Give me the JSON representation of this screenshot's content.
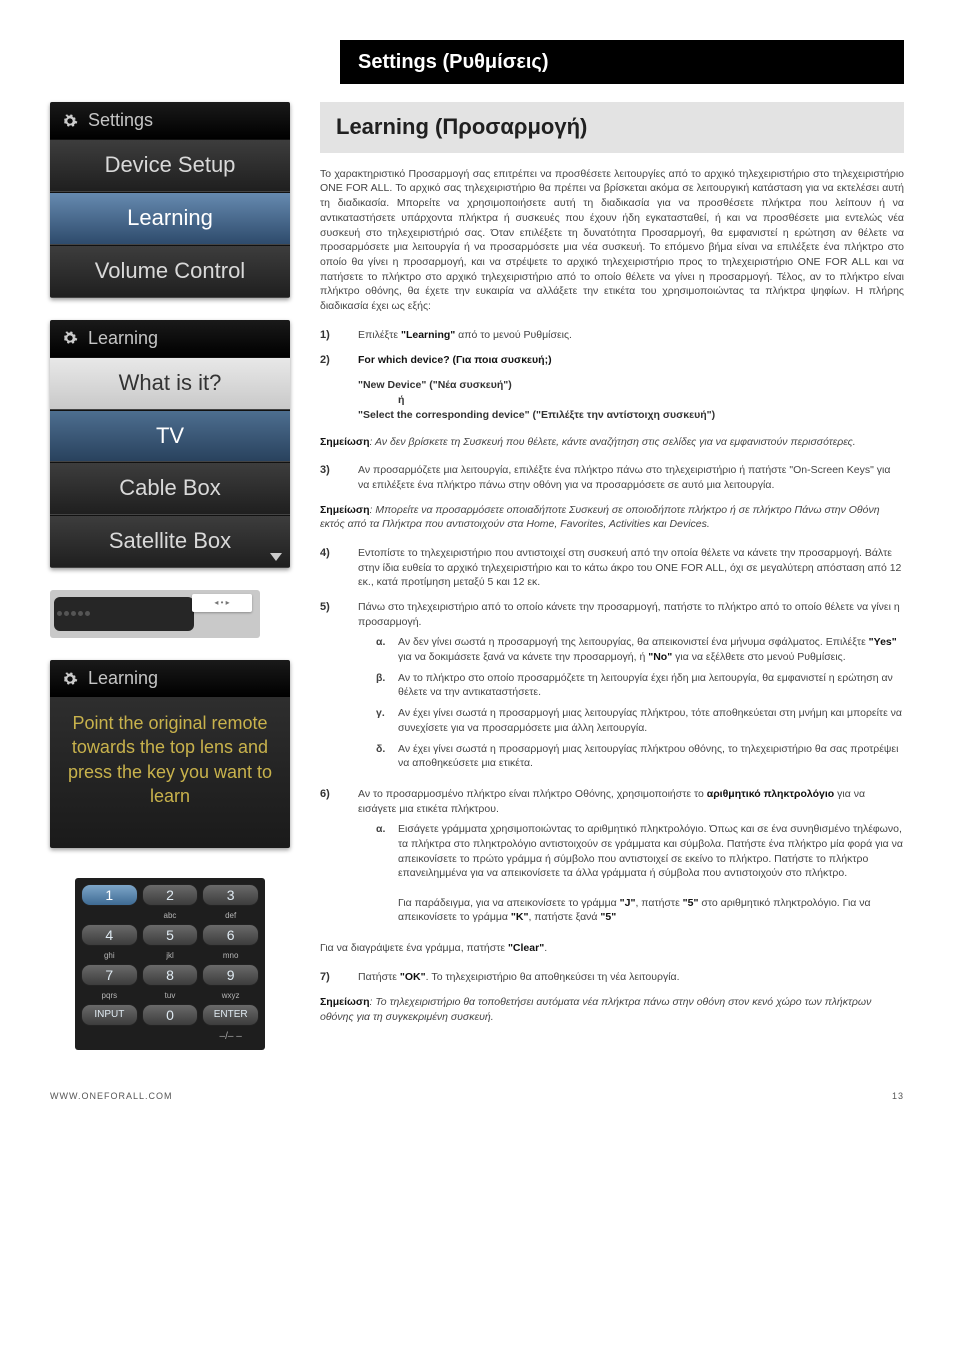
{
  "header_band": "Settings (Ρυθμίσεις)",
  "panel1": {
    "title": "Settings",
    "rows": [
      "Device Setup",
      "Learning",
      "Volume Control"
    ]
  },
  "panel2": {
    "title": "Learning",
    "rows": [
      "What is it?",
      "TV",
      "Cable Box",
      "Satellite Box"
    ]
  },
  "panel3": {
    "title": "Learning",
    "instructions": "Point the original remote towards the top lens and press the key you want to learn"
  },
  "keypad": {
    "r1": [
      "1",
      "2",
      "3"
    ],
    "s1": [
      "",
      "abc",
      "def"
    ],
    "r2": [
      "4",
      "5",
      "6"
    ],
    "s2": [
      "ghi",
      "jkl",
      "mno"
    ],
    "r3": [
      "7",
      "8",
      "9"
    ],
    "s3": [
      "pqrs",
      "tuv",
      "wxyz"
    ],
    "r4": [
      "INPUT",
      "0",
      "ENTER"
    ],
    "dash": "–/– –"
  },
  "main": {
    "title": "Learning (Προσαρμογή)",
    "intro": "Το χαρακτηριστικό Προσαρμογή σας επιτρέπει να προσθέσετε λειτουργίες από το αρχικό τηλεχειριστήριο στο τηλεχειριστήριο ONE FOR ALL. Το αρχικό σας τηλεχειριστήριο θα πρέπει να βρίσκεται ακόμα σε λειτουργική κατάσταση για να εκτελέσει αυτή τη διαδικασία. Μπορείτε να χρησιμοποιήσετε αυτή τη διαδικασία για να προσθέσετε πλήκτρα που λείπουν ή να αντικαταστήσετε υπάρχοντα πλήκτρα ή συσκευές που έχουν ήδη εγκατασταθεί, ή και να προσθέσετε μια εντελώς νέα συσκευή στο τηλεχειριστήριό σας. Όταν επιλέξετε τη δυνατότητα Προσαρμογή, θα εμφανιστεί η ερώτηση αν θέλετε να προσαρμόσετε μια λειτουργία ή να προσαρμόσετε μια νέα συσκευή. Το επόμενο βήμα είναι να επιλέξετε ένα πλήκτρο στο οποίο θα γίνει η προσαρμογή, και να στρέψετε το αρχικό τηλεχειριστήριο προς το τηλεχειριστήριο ONE FOR ALL και να πατήσετε το πλήκτρο στο αρχικό τηλεχειριστήριο από το οποίο θέλετε να γίνει η προσαρμογή. Τέλος, αν το πλήκτρο είναι πλήκτρο οθόνης, θα έχετε την ευκαιρία να αλλάξετε την ετικέτα του χρησιμοποιώντας τα πλήκτρα ψηφίων. Η πλήρης διαδικασία έχει ως εξής:",
    "step1_pre": "Επιλέξτε ",
    "step1_b": "\"Learning\"",
    "step1_post": " από το μενού Ρυθμίσεις.",
    "step2": "For which device? (Για ποια συσκευή;)",
    "step2_new": "\"New Device\" (\"Νέα συσκευή\")",
    "step2_or": "ή",
    "step2_sel": "\"Select the corresponding device\" (\"Επιλέξτε την αντίστοιχη συσκευή\")",
    "note1_lead": "Σημείωση",
    "note1_rest": ": Αν δεν βρίσκετε τη Συσκευή που θέλετε, κάντε αναζήτηση στις σελίδες για να εμφανιστούν περισσότερες.",
    "step3": "Αν προσαρμόζετε μια λειτουργία, επιλέξτε ένα πλήκτρο πάνω στο τηλεχειριστήριο ή πατήστε \"On-Screen Keys\" για να επιλέξετε ένα πλήκτρο πάνω στην οθόνη για να προσαρμόσετε σε αυτό μια λειτουργία.",
    "note2_lead": "Σημείωση",
    "note2_rest": ": Μπορείτε να προσαρμόσετε οποιαδήποτε Συσκευή σε οποιοδήποτε πλήκτρο ή σε πλήκτρο Πάνω στην Οθόνη εκτός από τα Πλήκτρα που αντιστοιχούν στα Home, Favorites, Activities και Devices.",
    "step4": "Εντοπίστε το τηλεχειριστήριο που αντιστοιχεί στη συσκευή από την οποία θέλετε να κάνετε την προσαρμογή. Βάλτε στην ίδια ευθεία το αρχικό τηλεχειριστήριο και το κάτω άκρο του ONE FOR ALL, όχι σε μεγαλύτερη απόσταση από 12 εκ., κατά προτίμηση μεταξύ 5 και 12 εκ.",
    "step5": "Πάνω στο τηλεχειριστήριο από το οποίο κάνετε την προσαρμογή, πατήστε το πλήκτρο από το οποίο θέλετε να γίνει η προσαρμογή.",
    "s5a_pre": "Αν δεν γίνει σωστά η προσαρμογή της λειτουργίας, θα απεικονιστεί ένα μήνυμα σφάλματος. Επιλέξτε ",
    "s5a_yes": "\"Yes\"",
    "s5a_mid": " για να δοκιμάσετε ξανά να κάνετε την προσαρμογή, ή ",
    "s5a_no": "\"No\"",
    "s5a_post": " για να εξέλθετε στο μενού Ρυθμίσεις.",
    "s5b": "Αν το πλήκτρο στο οποίο προσαρμόζετε τη λειτουργία έχει ήδη μια λειτουργία, θα εμφανιστεί η ερώτηση αν θέλετε να την αντικαταστήσετε.",
    "s5c": "Αν έχει γίνει σωστά η προσαρμογή μιας λειτουργίας πλήκτρου, τότε αποθηκεύεται στη μνήμη και μπορείτε να συνεχίσετε για να προσαρμόσετε μια άλλη λειτουργία.",
    "s5d": "Αν έχει γίνει σωστά η προσαρμογή μιας λειτουργίας πλήκτρου οθόνης, το τηλεχειριστήριο θα σας προτρέψει να αποθηκεύσετε μια ετικέτα.",
    "step6_pre": "Αν το προσαρμοσμένο πλήκτρο είναι πλήκτρο Οθόνης, χρησιμοποιήστε το ",
    "step6_b": "αριθμητικό πληκτρολόγιο",
    "step6_post": " για να εισάγετε μια ετικέτα πλήκτρου.",
    "s6a_p1": "Εισάγετε γράμματα χρησιμοποιώντας το αριθμητικό πληκτρολόγιο. Όπως και σε ένα συνηθισμένο τηλέφωνο, τα πλήκτρα στο πληκτρολόγιο αντιστοιχούν σε γράμματα και σύμβολα. Πατήστε ένα πλήκτρο μία φορά για να απεικονίσετε το πρώτο γράμμα ή σύμβολο που αντιστοιχεί σε εκείνο το πλήκτρο. Πατήστε το πλήκτρο επανειλημμένα για να απεικονίσετε τα άλλα γράμματα ή σύμβολα που αντιστοιχούν στο πλήκτρο.",
    "s6a_p2_pre": "Για παράδειγμα, για να απεικονίσετε το γράμμα ",
    "s6a_j": "\"J\"",
    "s6a_p2_mid1": ", πατήστε ",
    "s6a_5a": "\"5\"",
    "s6a_p2_mid2": " στο αριθμητικό πληκτρολόγιο. Για να απεικονίσετε το γράμμα ",
    "s6a_k": "\"K\"",
    "s6a_p2_mid3": ", πατήστε ξανά ",
    "s6a_5b": "\"5\"",
    "delete_pre": "Για να διαγράψετε ένα γράμμα, πατήστε ",
    "delete_b": "\"Clear\"",
    "delete_post": ".",
    "step7_pre": "Πατήστε ",
    "step7_b": "\"OK\"",
    "step7_post": ". Το τηλεχειριστήριο θα αποθηκεύσει τη νέα λειτουργία.",
    "note3_lead": "Σημείωση",
    "note3_rest": ": Το τηλεχειριστήριο θα τοποθετήσει αυτόματα νέα πλήκτρα πάνω στην οθόνη στον κενό χώρο των πλήκτρων οθόνης για τη συγκεκριμένη συσκευή."
  },
  "footer": {
    "left": "WWW.ONEFORALL.COM",
    "right": "13"
  },
  "labels": {
    "a": "α.",
    "b": "β.",
    "c": "γ.",
    "d": "δ.",
    "a2": "α."
  }
}
